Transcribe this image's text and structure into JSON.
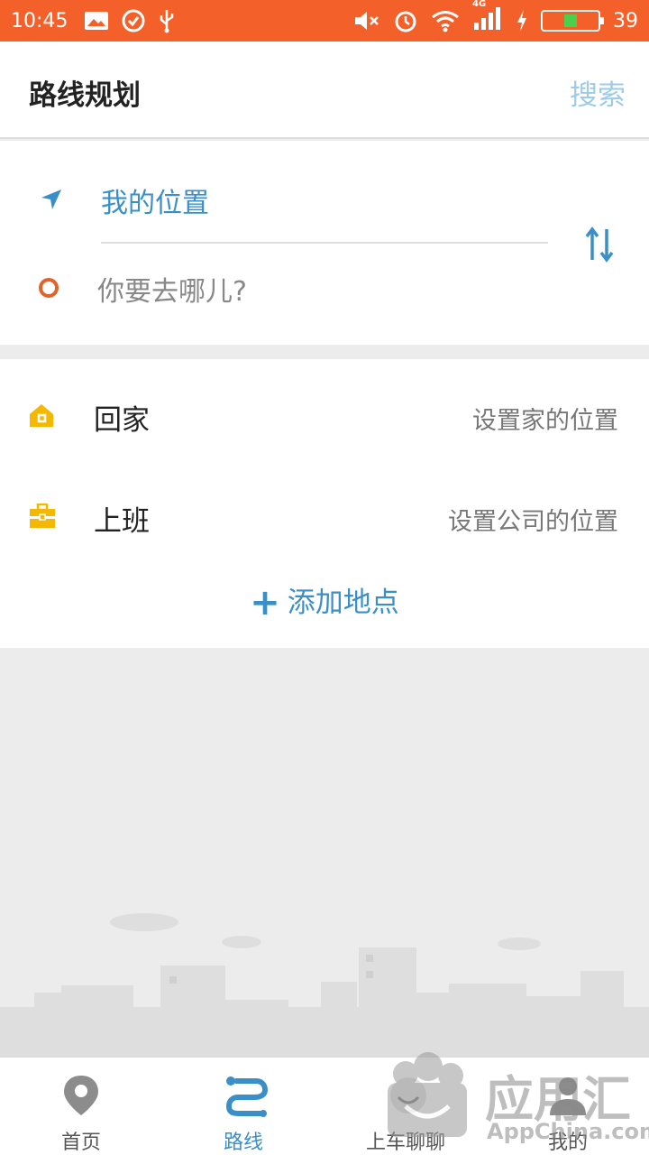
{
  "status_bar": {
    "time": "10:45",
    "battery_level": "39",
    "network": "4G"
  },
  "header": {
    "title": "路线规划",
    "search_label": "搜索"
  },
  "route": {
    "from_label": "我的位置",
    "to_placeholder": "你要去哪儿?"
  },
  "places": [
    {
      "label": "回家",
      "action": "设置家的位置",
      "icon": "home-icon"
    },
    {
      "label": "上班",
      "action": "设置公司的位置",
      "icon": "briefcase-icon"
    }
  ],
  "add_place_label": "添加地点",
  "bottom_nav": [
    {
      "label": "首页",
      "icon": "location-pin-icon",
      "active": false
    },
    {
      "label": "路线",
      "icon": "route-icon",
      "active": true
    },
    {
      "label": "上车聊聊",
      "icon": "chat-icon",
      "active": false
    },
    {
      "label": "我的",
      "icon": "profile-icon",
      "active": false
    }
  ],
  "watermark": {
    "text": "应用汇",
    "sub": "AppChina.com"
  },
  "colors": {
    "status_bar": "#f46029",
    "accent": "#3a8fc8",
    "destination": "#e2622a",
    "place_icon": "#f5b800"
  }
}
